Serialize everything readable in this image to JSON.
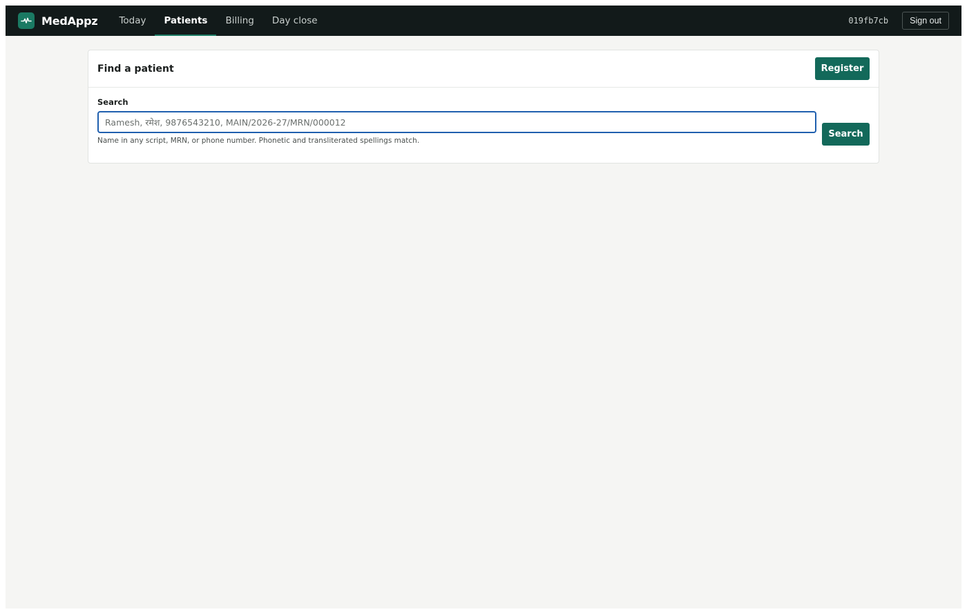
{
  "header": {
    "brand": "MedAppz",
    "nav": [
      {
        "label": "Today",
        "active": false
      },
      {
        "label": "Patients",
        "active": true
      },
      {
        "label": "Billing",
        "active": false
      },
      {
        "label": "Day close",
        "active": false
      }
    ],
    "session_id": "019fb7cb",
    "signout_label": "Sign out"
  },
  "find_patient": {
    "title": "Find a patient",
    "register_label": "Register",
    "search_label": "Search",
    "search_value": "",
    "search_placeholder": "Ramesh, रमेश, 9876543210, MAIN/2026-27/MRN/000012",
    "hint": "Name in any script, MRN, or phone number. Phonetic and transliterated spellings match.",
    "search_button_label": "Search"
  },
  "colors": {
    "topbar_bg": "#121a1a",
    "accent": "#13695a",
    "focus_border": "#1f5fae",
    "page_bg": "#f5f5f3"
  },
  "icons": {
    "brand_logo": "pulse-icon"
  }
}
